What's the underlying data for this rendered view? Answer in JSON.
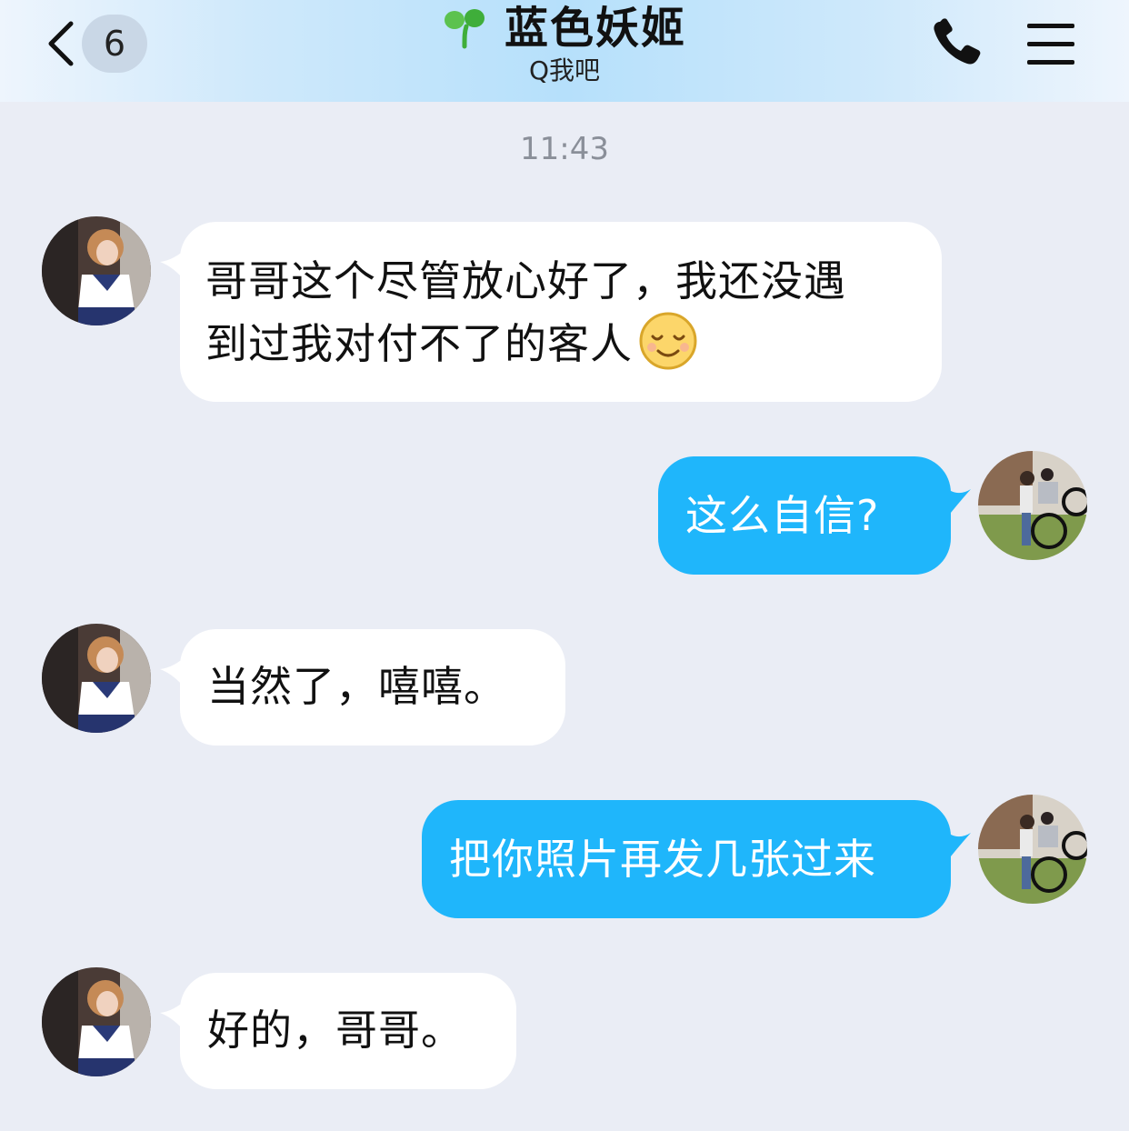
{
  "header": {
    "unread_count": "6",
    "title": "蓝色妖姬",
    "subtitle": "Q我吧"
  },
  "timestamp": "11:43",
  "messages": [
    {
      "side": "in",
      "line1": "哥哥这个尽管放心好了，我还没遇",
      "line2": "到过我对付不了的客人",
      "emoji": "smile-emoji"
    },
    {
      "side": "out",
      "text": "这么自信?"
    },
    {
      "side": "in",
      "text": "当然了，嘻嘻。"
    },
    {
      "side": "out",
      "text": "把你照片再发几张过来"
    },
    {
      "side": "in",
      "text": "好的，哥哥。"
    }
  ],
  "colors": {
    "background": "#eaedf5",
    "incoming_bubble": "#ffffff",
    "outgoing_bubble": "#1fb6fb",
    "header_gradient_center": "#b6e0fb",
    "timestamp": "#8a8f99"
  },
  "icons": [
    "back-chevron-icon",
    "sprout-icon",
    "phone-icon",
    "menu-icon",
    "smile-emoji"
  ]
}
